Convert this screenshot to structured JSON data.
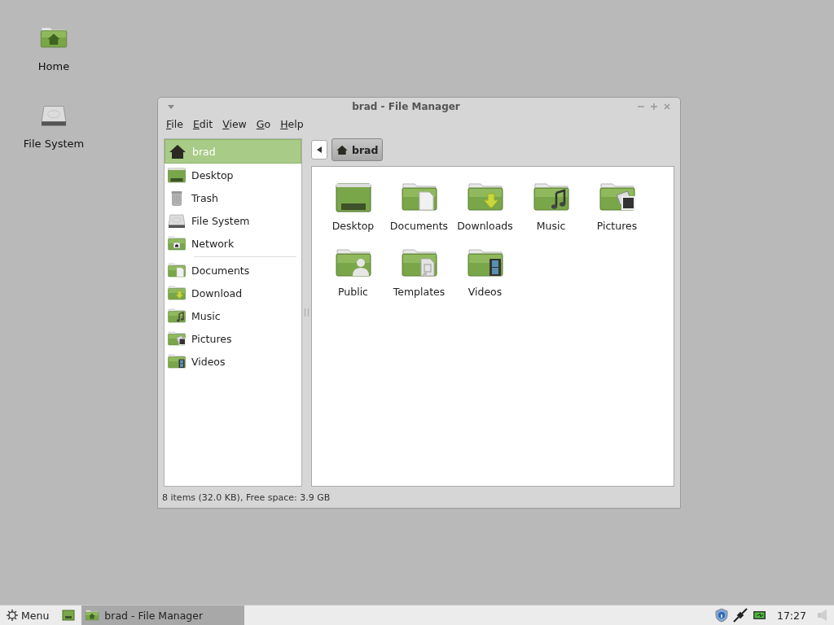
{
  "desktop_icons": [
    {
      "label": "Home",
      "kind": "home"
    },
    {
      "label": "File System",
      "kind": "drive"
    }
  ],
  "window": {
    "title": "brad - File Manager"
  },
  "menu_bar": [
    "File",
    "Edit",
    "View",
    "Go",
    "Help"
  ],
  "sidebar": {
    "sections": [
      [
        {
          "label": "brad",
          "kind": "home",
          "selected": true
        },
        {
          "label": "Desktop",
          "kind": "desktop",
          "selected": false
        },
        {
          "label": "Trash",
          "kind": "trash",
          "selected": false
        },
        {
          "label": "File System",
          "kind": "drive",
          "selected": false
        },
        {
          "label": "Network",
          "kind": "network",
          "selected": false
        }
      ],
      [
        {
          "label": "Documents",
          "kind": "documents",
          "selected": false
        },
        {
          "label": "Download",
          "kind": "download",
          "selected": false
        },
        {
          "label": "Music",
          "kind": "music",
          "selected": false
        },
        {
          "label": "Pictures",
          "kind": "pictures",
          "selected": false
        },
        {
          "label": "Videos",
          "kind": "videos",
          "selected": false
        }
      ]
    ]
  },
  "path_bar": {
    "crumbs": [
      {
        "label": "brad",
        "kind": "home"
      }
    ]
  },
  "files": [
    {
      "label": "Desktop",
      "kind": "desktop"
    },
    {
      "label": "Documents",
      "kind": "documents"
    },
    {
      "label": "Downloads",
      "kind": "download"
    },
    {
      "label": "Music",
      "kind": "music"
    },
    {
      "label": "Pictures",
      "kind": "pictures"
    },
    {
      "label": "Public",
      "kind": "public"
    },
    {
      "label": "Templates",
      "kind": "templates"
    },
    {
      "label": "Videos",
      "kind": "videos"
    }
  ],
  "status_bar": "8 items (32.0 KB), Free space: 3.9 GB",
  "taskbar": {
    "menu_label": "Menu",
    "tasks": [
      {
        "label": "brad - File Manager",
        "selected": true
      }
    ],
    "clock": "17:27"
  }
}
